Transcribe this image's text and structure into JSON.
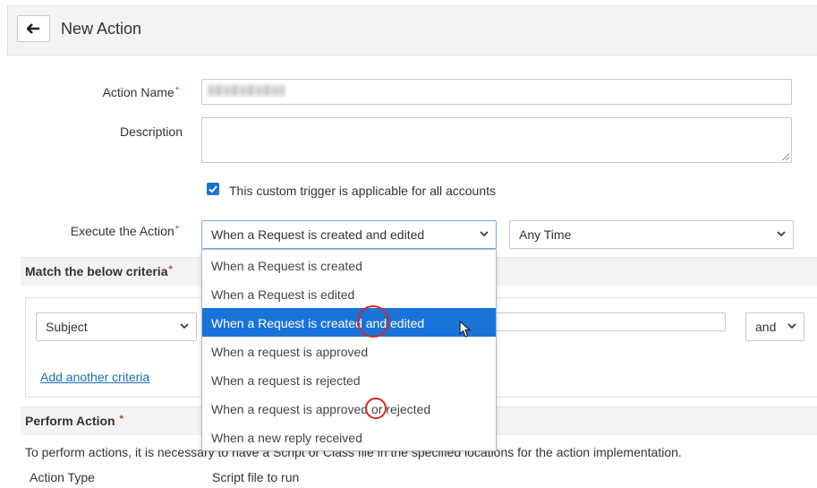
{
  "header": {
    "title": "New Action",
    "back_icon": "arrow-left-icon"
  },
  "form": {
    "action_name_label": "Action Name",
    "description_label": "Description",
    "required_mark": "*",
    "checkbox_label": "This custom trigger is applicable for all accounts",
    "checkbox_checked": true,
    "execute_label": "Execute the Action",
    "execute_value": "When a Request is created and edited",
    "time_value": "Any Time"
  },
  "criteria": {
    "title": "Match the below criteria",
    "field_value": "Subject",
    "join_value": "and",
    "add_link": "Add another criteria"
  },
  "perform": {
    "title": "Perform Action",
    "text": "To perform actions, it is necessary to have a Script or Class file in the specified locations for the action implementation.",
    "col_action_type": "Action Type",
    "col_script": "Script file to run"
  },
  "dropdown": {
    "options": [
      "When a Request is created",
      "When a Request is edited",
      "When a Request is created and edited",
      "When a request is approved",
      "When a request is rejected",
      "When a request is approved or rejected",
      "When a new reply received"
    ],
    "selected_index": 2
  },
  "colors": {
    "accent": "#1a73d9",
    "required": "#d9302b",
    "annotation": "#d12a2a",
    "link": "#1a6db5"
  }
}
